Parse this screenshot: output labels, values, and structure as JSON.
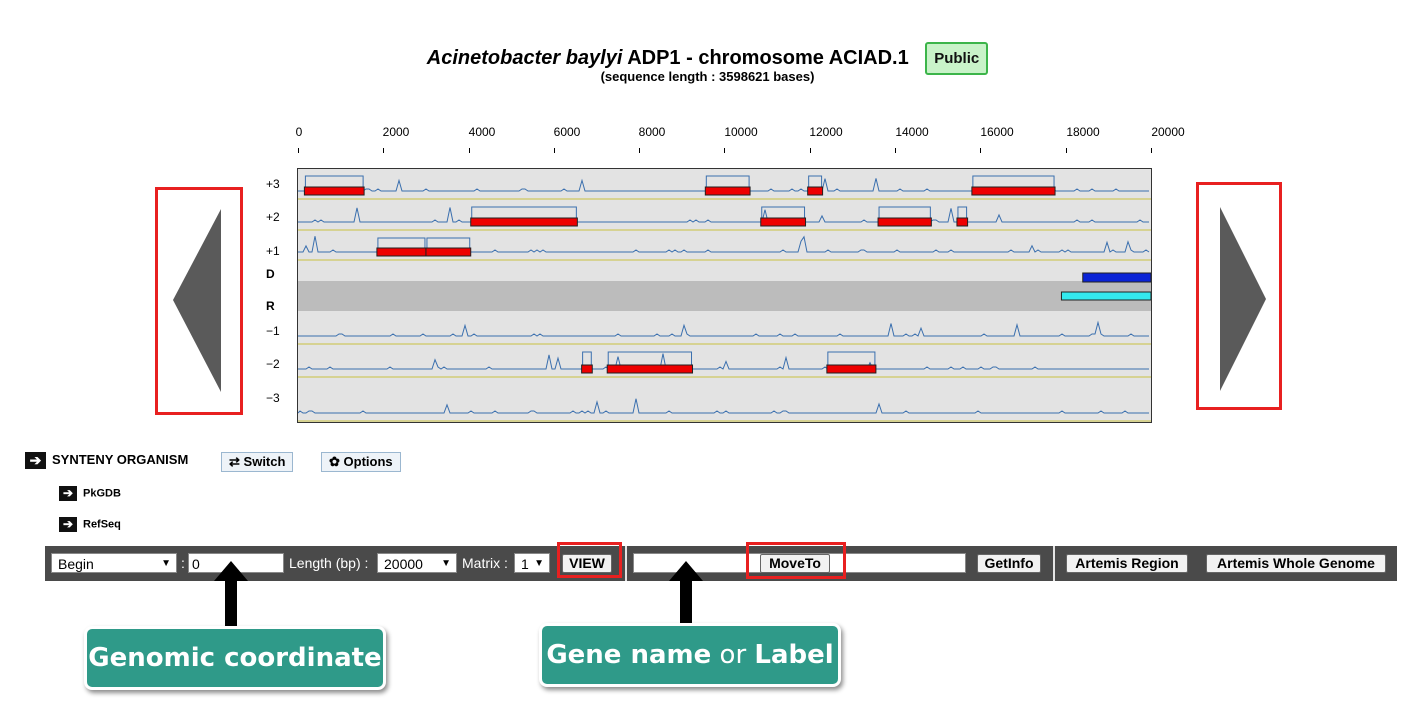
{
  "header": {
    "organism_italic": "Acinetobacter baylyi",
    "title_rest": " ADP1 - chromosome ACIAD.1",
    "badge": "Public",
    "sequence_length": "(sequence length : 3598621 bases)"
  },
  "scale": {
    "labels": [
      "0",
      "2000",
      "4000",
      "6000",
      "8000",
      "10000",
      "12000",
      "14000",
      "16000",
      "18000",
      "20000"
    ]
  },
  "frames": [
    "+3",
    "+2",
    "+1",
    "D",
    "R",
    "−1",
    "−2",
    "−3"
  ],
  "viewer": {
    "range_bp": [
      0,
      20000
    ],
    "genes": [
      {
        "frame": "+3",
        "start": 150,
        "end": 1550
      },
      {
        "frame": "+3",
        "start": 9550,
        "end": 10600
      },
      {
        "frame": "+3",
        "start": 11950,
        "end": 12300
      },
      {
        "frame": "+3",
        "start": 15800,
        "end": 17750
      },
      {
        "frame": "+2",
        "start": 4050,
        "end": 6550
      },
      {
        "frame": "+2",
        "start": 10850,
        "end": 11900
      },
      {
        "frame": "+2",
        "start": 13600,
        "end": 14850
      },
      {
        "frame": "+2",
        "start": 15450,
        "end": 15700
      },
      {
        "frame": "+1",
        "start": 1850,
        "end": 3000
      },
      {
        "frame": "+1",
        "start": 3000,
        "end": 4050
      },
      {
        "frame": "−2",
        "start": 6650,
        "end": 6900
      },
      {
        "frame": "−2",
        "start": 7250,
        "end": 9250
      },
      {
        "frame": "−2",
        "start": 12400,
        "end": 13550
      }
    ],
    "d_feature": {
      "start": 18400,
      "end": 20000,
      "color": "#0a23d6"
    },
    "r_feature": {
      "start": 17900,
      "end": 20000,
      "color": "#33e9ee"
    }
  },
  "synteny": {
    "title": "SYNTENY ORGANISM",
    "switch_label": "Switch",
    "options_label": "Options",
    "sources": [
      "PkGDB",
      "RefSeq"
    ]
  },
  "toolbar": {
    "position_select": "Begin",
    "coordinate_value": "0",
    "length_label": "Length (bp) :",
    "length_value": "20000",
    "matrix_label": "Matrix :",
    "matrix_value": "1",
    "view_button": "VIEW",
    "gene_input_value": "",
    "moveto_button": "MoveTo",
    "info_input_value": "",
    "getinfo_button": "GetInfo",
    "artemis_region_button": "Artemis Region",
    "artemis_genome_button": "Artemis Whole Genome"
  },
  "callouts": {
    "coordinate": "Genomic coordinate",
    "gene_word1": "Gene name",
    "gene_or": "or",
    "gene_word2": "Label"
  },
  "colors": {
    "gene": "#ee0000",
    "trace": "#3a6fae",
    "frame_line": "#c8c040",
    "highlight": "#e82020",
    "callout": "#2f9a89"
  }
}
